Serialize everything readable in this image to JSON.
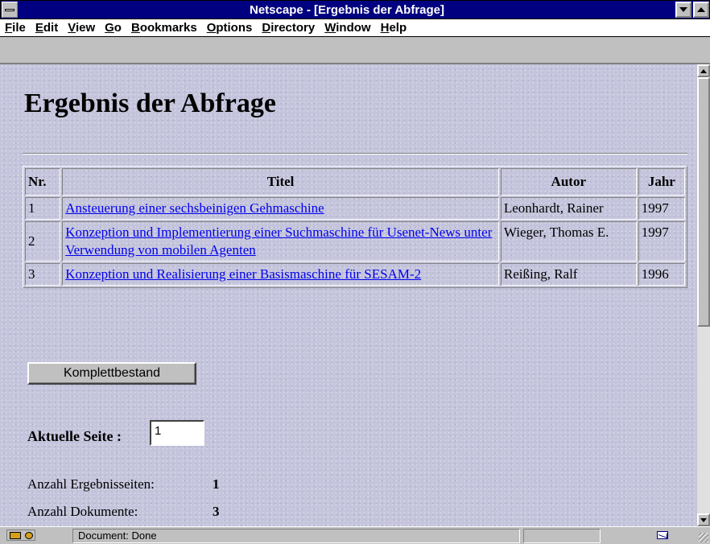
{
  "window": {
    "title": "Netscape - [Ergebnis der Abfrage]"
  },
  "menu": {
    "items": [
      {
        "label": "File",
        "mnemonic": "F",
        "rest": "ile"
      },
      {
        "label": "Edit",
        "mnemonic": "E",
        "rest": "dit"
      },
      {
        "label": "View",
        "mnemonic": "V",
        "rest": "iew"
      },
      {
        "label": "Go",
        "mnemonic": "G",
        "rest": "o"
      },
      {
        "label": "Bookmarks",
        "mnemonic": "B",
        "rest": "ookmarks"
      },
      {
        "label": "Options",
        "mnemonic": "O",
        "rest": "ptions"
      },
      {
        "label": "Directory",
        "mnemonic": "D",
        "rest": "irectory"
      },
      {
        "label": "Window",
        "mnemonic": "W",
        "rest": "indow"
      },
      {
        "label": "Help",
        "mnemonic": "H",
        "rest": "elp"
      }
    ]
  },
  "page": {
    "title": "Ergebnis der Abfrage",
    "table": {
      "headers": [
        "Nr.",
        "Titel",
        "Autor",
        "Jahr"
      ],
      "rows": [
        {
          "nr": "1",
          "titel": "Ansteuerung einer sechsbeinigen Gehmaschine",
          "autor": "Leonhardt, Rainer",
          "jahr": "1997"
        },
        {
          "nr": "2",
          "titel": "Konzeption und Implementierung einer Suchmaschine für Usenet-News unter Verwendung von mobilen Agenten",
          "autor": "Wieger, Thomas E.",
          "jahr": "1997"
        },
        {
          "nr": "3",
          "titel": "Konzeption und Realisierung einer Basismaschine für SESAM-2",
          "autor": "Reißing, Ralf",
          "jahr": "1996"
        }
      ]
    },
    "button_label": "Komplettbestand",
    "current_page_label": "Aktuelle Seite :",
    "current_page_value": "1",
    "stats": {
      "pages_label": "Anzahl Ergebnisseiten:",
      "pages_value": "1",
      "docs_label": "Anzahl Dokumente:",
      "docs_value": "3"
    }
  },
  "status": {
    "text": "Document: Done"
  },
  "colors": {
    "titlebar": "#000080",
    "link": "#0000ee",
    "background": "#c4c4dc"
  }
}
